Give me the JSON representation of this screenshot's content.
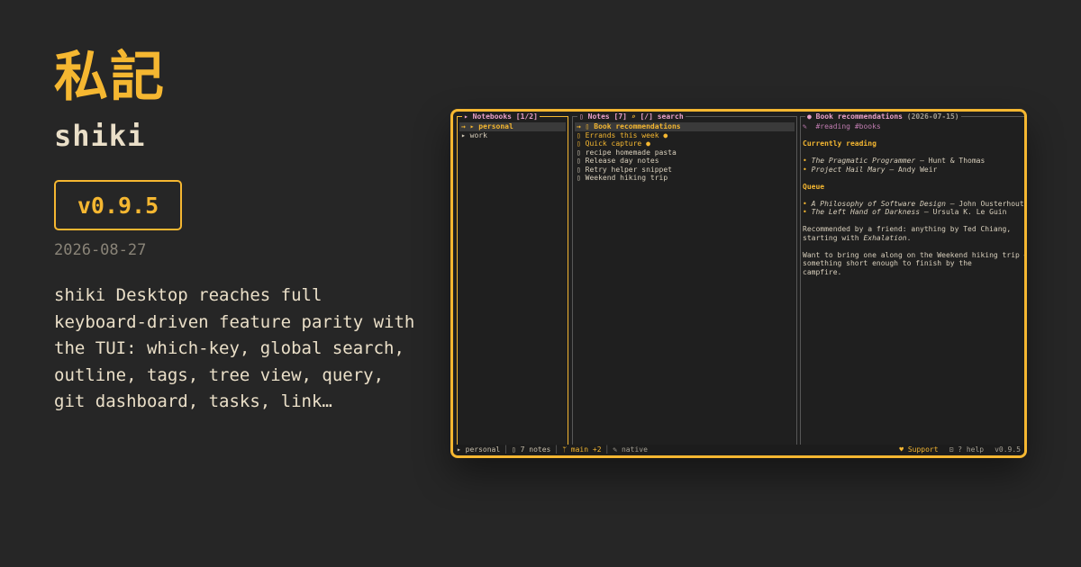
{
  "brand": {
    "kanji": "私記",
    "name": "shiki",
    "version": "v0.9.5",
    "date": "2026-08-27",
    "description": "shiki Desktop reaches full keyboard-driven feature parity with the TUI: which-key, global search, outline, tags, tree view, query, git dashboard, tasks, link…"
  },
  "colors": {
    "accent": "#f5b731",
    "background": "#262626",
    "tag": "#c07cb0",
    "pane_title": "#e8a0c8"
  },
  "notebooks": {
    "title": "Notebooks [1/2]",
    "items": [
      {
        "label": "→ ▸ personal",
        "selected": true
      },
      {
        "label": "  ▸ work",
        "selected": false
      }
    ]
  },
  "notes": {
    "title": "Notes [7]",
    "search": "[/] search",
    "items": [
      {
        "label": "→ ▯ Book recommendations",
        "state": "selected"
      },
      {
        "label": "  ▯ Errands this week ●",
        "state": "highlight"
      },
      {
        "label": "  ▯ Quick capture ●",
        "state": "highlight"
      },
      {
        "label": "  ▯ recipe homemade pasta",
        "state": "normal"
      },
      {
        "label": "  ▯ Release day notes",
        "state": "normal"
      },
      {
        "label": "  ▯ Retry helper snippet",
        "state": "normal"
      },
      {
        "label": "  ▯ Weekend hiking trip",
        "state": "normal"
      }
    ]
  },
  "preview": {
    "title": "Book recommendations",
    "date": "(2026-07-15)",
    "tag_icon": "✎",
    "tags": "#reading #books",
    "h1": "Currently reading",
    "reading": [
      {
        "bullet": "•",
        "title": "The Pragmatic Programmer",
        "author": " — Hunt & Thomas"
      },
      {
        "bullet": "•",
        "title": "Project Hail Mary",
        "author": " — Andy Weir"
      }
    ],
    "h2": "Queue",
    "queue": [
      {
        "bullet": "•",
        "title": "A Philosophy of Software Design",
        "author": " — John Ousterhout"
      },
      {
        "bullet": "•",
        "title": "The Left Hand of Darkness",
        "author": " — Ursula K. Le Guin"
      }
    ],
    "para1_a": "Recommended by a friend: anything by Ted Chiang,",
    "para1_b": "starting with ",
    "para1_em": "Exhalation",
    "para1_end": ".",
    "para2_a": "Want to bring one along on the Weekend hiking trip —",
    "para2_b": "something short enough to finish by the",
    "para2_c": "campfire."
  },
  "status": {
    "notebook": "▸ personal",
    "notes": "▯ 7 notes",
    "git": "ᛘ main +2",
    "mode": "✎ native",
    "support": "♥ Support",
    "help": "⊡ ? help",
    "version": "v0.9.5"
  }
}
